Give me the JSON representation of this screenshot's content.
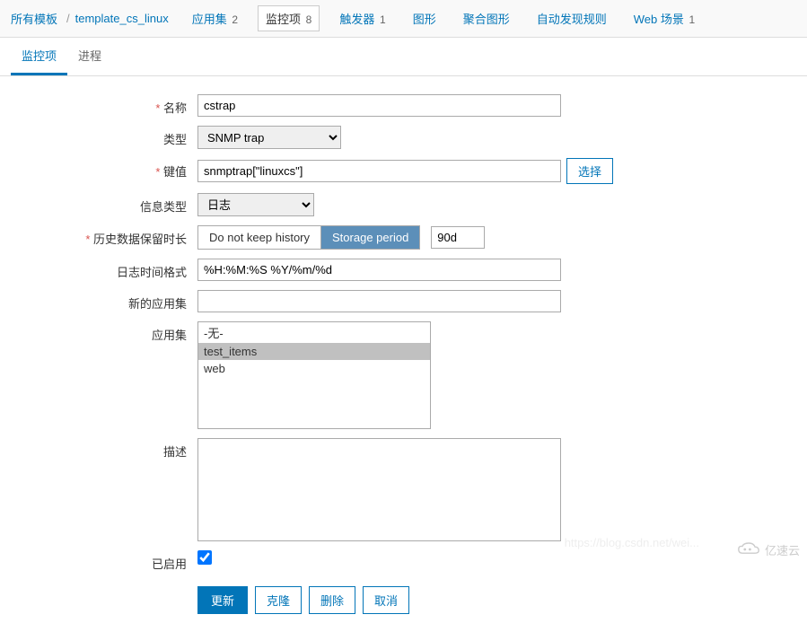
{
  "breadcrumb": {
    "all_templates": "所有模板",
    "template_name": "template_cs_linux"
  },
  "topnav": {
    "applications": {
      "label": "应用集",
      "count": "2"
    },
    "items": {
      "label": "监控项",
      "count": "8"
    },
    "triggers": {
      "label": "触发器",
      "count": "1"
    },
    "graphs": {
      "label": "图形",
      "count": ""
    },
    "screens": {
      "label": "聚合图形",
      "count": ""
    },
    "discovery": {
      "label": "自动发现规则",
      "count": ""
    },
    "web": {
      "label": "Web 场景",
      "count": "1"
    }
  },
  "subnav": {
    "item": "监控项",
    "process": "进程"
  },
  "form": {
    "name_label": "名称",
    "name_value": "cstrap",
    "type_label": "类型",
    "type_value": "SNMP trap",
    "key_label": "键值",
    "key_value": "snmptrap[\"linuxcs\"]",
    "key_select": "选择",
    "info_label": "信息类型",
    "info_value": "日志",
    "history_label": "历史数据保留时长",
    "history_opt1": "Do not keep history",
    "history_opt2": "Storage period",
    "history_value": "90d",
    "logtime_label": "日志时间格式",
    "logtime_value": "%H:%M:%S %Y/%m/%d",
    "newapp_label": "新的应用集",
    "newapp_value": "",
    "apps_label": "应用集",
    "apps_options": [
      "-无-",
      "test_items",
      "web"
    ],
    "desc_label": "描述",
    "desc_value": "",
    "enabled_label": "已启用"
  },
  "actions": {
    "update": "更新",
    "clone": "克隆",
    "delete": "删除",
    "cancel": "取消"
  },
  "watermark": {
    "blog": "https://blog.csdn.net/wei...",
    "brand": "亿速云"
  }
}
